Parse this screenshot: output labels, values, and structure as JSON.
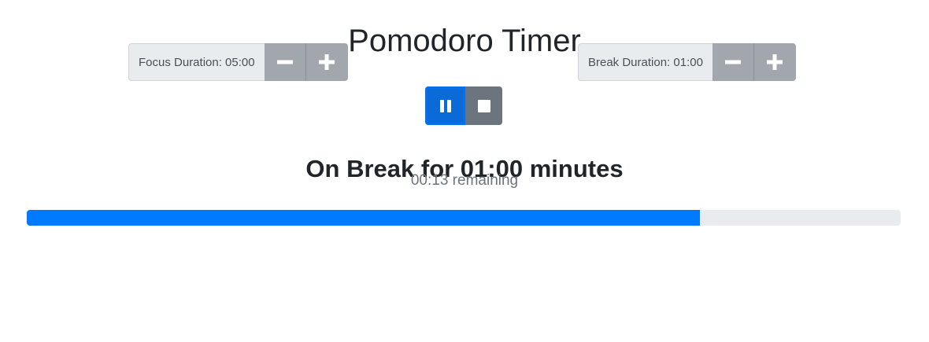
{
  "app": {
    "title": "Pomodoro Timer"
  },
  "focus": {
    "label": "Focus Duration: 05:00"
  },
  "break": {
    "label": "Break Duration: 01:00"
  },
  "controls": {
    "pause_icon": "pause-icon",
    "stop_icon": "stop-icon",
    "minus_icon": "minus-icon",
    "plus_icon": "plus-icon"
  },
  "status": {
    "heading": "On Break for 01:00 minutes",
    "remaining": "00:13 remaining",
    "progress_percent": 77
  },
  "colors": {
    "primary": "#007bff",
    "secondary": "#6c757d",
    "stepper": "#a2a7ad",
    "track": "#e9ecef"
  }
}
